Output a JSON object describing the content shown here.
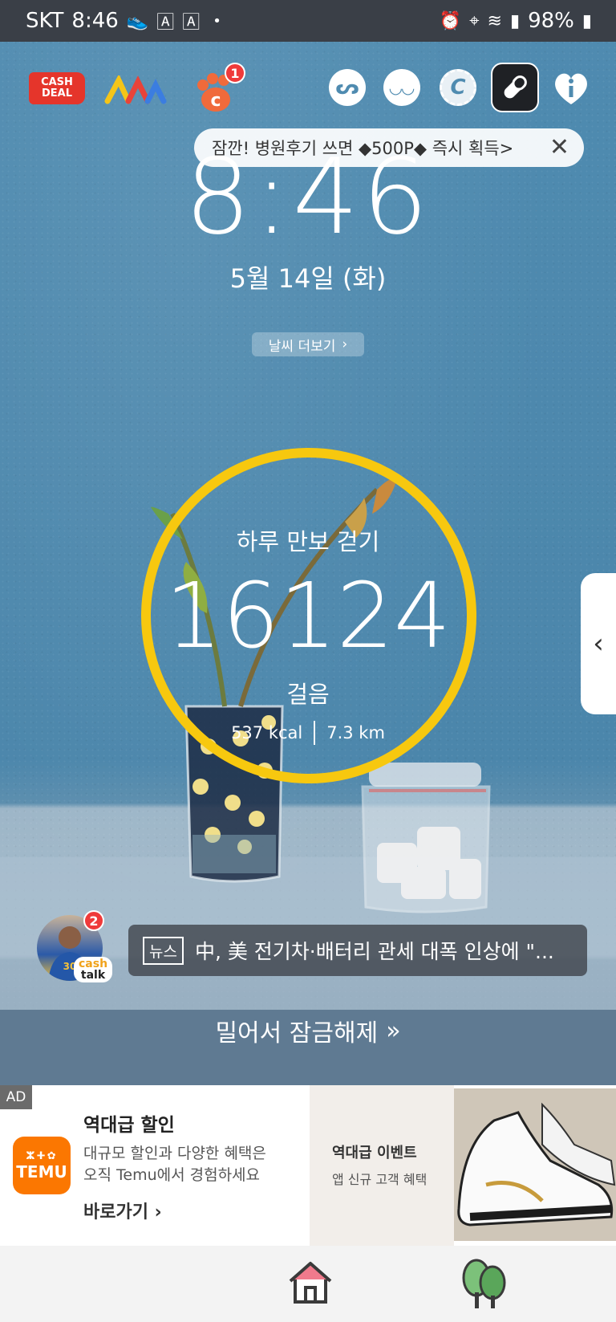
{
  "status_bar": {
    "carrier": "SKT",
    "time": "8:46",
    "dot": "•",
    "battery": "98%"
  },
  "top_icons": {
    "cash_deal_line1": "CASH",
    "cash_deal_line2": "DEAL",
    "paw_badge": "1"
  },
  "toast": {
    "text": "잠깐! 병원후기 쓰면 ◆500P◆ 즉시 획득>",
    "close": "✕"
  },
  "lock": {
    "time": "8:46",
    "date": "5월 14일 (화)",
    "weather_label": "날씨 더보기",
    "weather_chevron": "›"
  },
  "steps": {
    "title": "하루 만보 걷기",
    "count": "16124",
    "unit": "걸음",
    "kcal": "537 kcal",
    "distance": "7.3 km",
    "progress_fraction": 1.0
  },
  "side_handle": {
    "chevron": "‹"
  },
  "cash_talk": {
    "badge": "2",
    "tag_line1": "cash",
    "tag_line2": "talk"
  },
  "news": {
    "tag": "뉴스",
    "headline": "中, 美 전기차·배터리 관세 대폭 인상에 \"..."
  },
  "unlock": {
    "label": "밀어서 잠금해제",
    "arrows": "»"
  },
  "ad": {
    "label": "AD",
    "brand_logo_text": "TEMU",
    "brand_logo_top": "ⵣⵜ✿",
    "headline": "역대급 할인",
    "desc_line1": "대규모 할인과 다양한 혜택은",
    "desc_line2": "오직 Temu에서 경험하세요",
    "cta": "바로가기",
    "cta_chevron": "›",
    "event_title": "역대급 이벤트",
    "event_sub": "앱 신규 고객 혜택"
  },
  "colors": {
    "ring": "#f7c80f",
    "status_bar": "#3a3f47",
    "wallpaper": "#4d88ad",
    "badge": "#ef3a3a",
    "temu": "#fb7701"
  }
}
